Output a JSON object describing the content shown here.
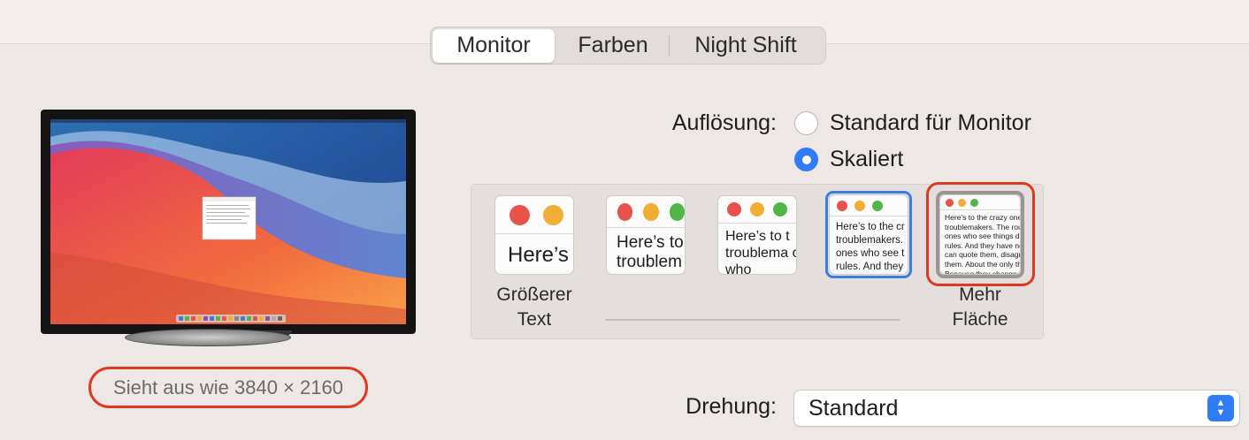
{
  "tabs": [
    {
      "label": "Monitor",
      "active": true
    },
    {
      "label": "Farben",
      "active": false
    },
    {
      "label": "Night Shift",
      "active": false
    }
  ],
  "display_preview": {
    "looks_like": "Sieht aus wie 3840 × 2160"
  },
  "resolution": {
    "label": "Auflösung:",
    "options": [
      {
        "label": "Standard für Monitor",
        "checked": false
      },
      {
        "label": "Skaliert",
        "checked": true
      }
    ]
  },
  "scale": {
    "sample_text": "Here’s to the crazy ones troublemakers. The round ones who see things differently. rules. And they have no can quote them, disagree them. About the only th Because they change th",
    "caption_left_line1": "Größerer",
    "caption_left_line2": "Text",
    "caption_right_line1": "Mehr",
    "caption_right_line2": "Fläche",
    "options": [
      {
        "name": "largest",
        "text": "Here’s"
      },
      {
        "name": "larger",
        "text": "Here’s to troublem"
      },
      {
        "name": "medium",
        "text": "Here’s to t troublema ones who"
      },
      {
        "name": "selected",
        "text": "Here’s to the cr troublemakers. ones who see t rules. And they"
      },
      {
        "name": "more-space",
        "text": "Here’s to the crazy ones troublemakers. The roun ones who see things diff rules. And they have no can quote them, disagre them. About the only th Because they change th"
      }
    ],
    "selected_index": 3
  },
  "rotation": {
    "label": "Drehung:",
    "value": "Standard"
  },
  "colors": {
    "accent": "#2f7cf6",
    "highlight": "#e0391f",
    "selection": "#3c7ee0"
  }
}
